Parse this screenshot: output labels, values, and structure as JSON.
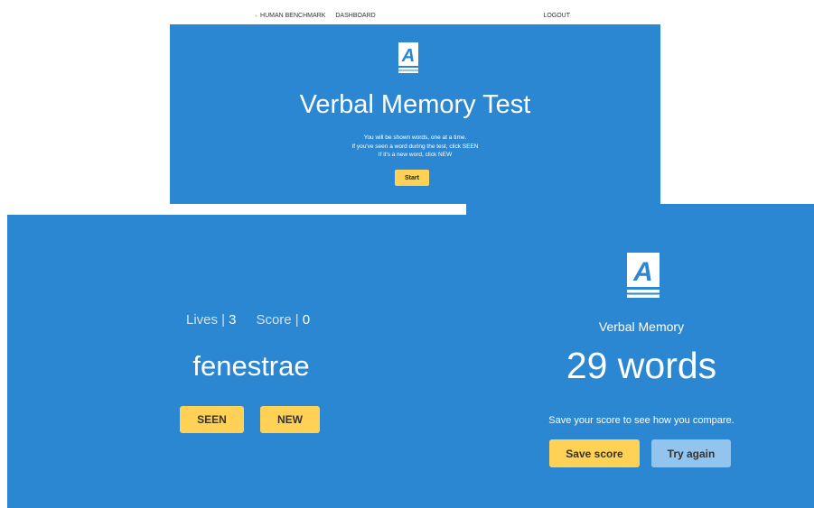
{
  "nav": {
    "brand": "HUMAN BENCHMARK",
    "dashboard": "DASHBOARD",
    "logout": "LOGOUT"
  },
  "start_screen": {
    "logo_icon": "verbal-book-icon",
    "title": "Verbal Memory Test",
    "instructions": [
      "You will be shown words, one at a time.",
      "If you've seen a word during the test, click SEEN",
      "If it's a new word, click NEW"
    ],
    "start_label": "Start"
  },
  "game": {
    "lives_label": "Lives |",
    "lives_value": "3",
    "score_label": "Score |",
    "score_value": "0",
    "word": "fenestrae",
    "seen_label": "SEEN",
    "new_label": "NEW"
  },
  "result": {
    "logo_icon": "verbal-book-icon",
    "label": "Verbal Memory",
    "score": "29 words",
    "message": "Save your score to see how you compare.",
    "save_label": "Save score",
    "try_label": "Try again"
  },
  "colors": {
    "background_blue": "#2b87d1",
    "accent_yellow": "#ffd154",
    "secondary_button": "#93c4ee"
  }
}
